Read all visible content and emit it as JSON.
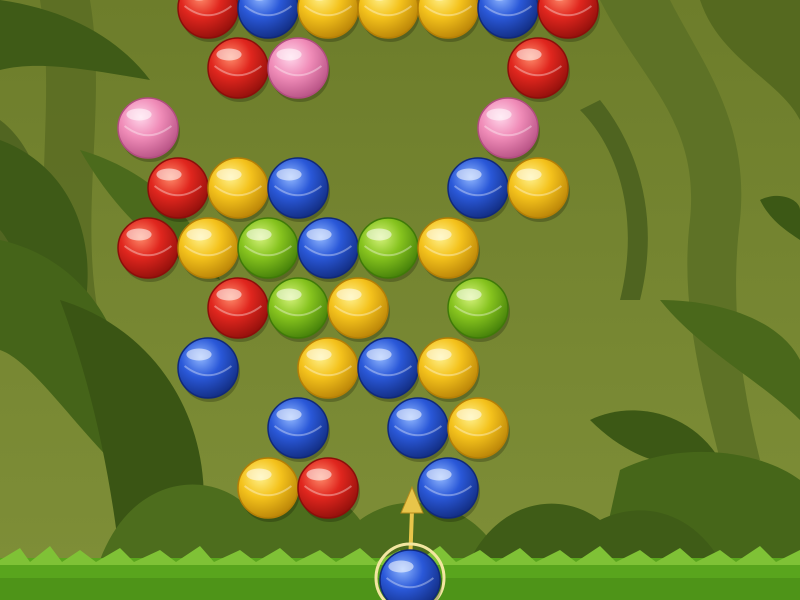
{
  "theme": {
    "sky": "#6f7f2e",
    "jungle_dark": "#3f5a18",
    "jungle_mid": "#556f22",
    "jungle_light": "#7e9238",
    "grass": "#5aa61f",
    "grass_light": "#8cc63f",
    "arrow": "#e8c54a"
  },
  "bubble_colors": {
    "red": {
      "base": "#e0261e",
      "light": "#ff8a6a",
      "dark": "#8c0e0a"
    },
    "blue": {
      "base": "#2a58d8",
      "light": "#8fb6ff",
      "dark": "#10297a"
    },
    "yellow": {
      "base": "#f4c21c",
      "light": "#fff08a",
      "dark": "#b57f06"
    },
    "pink": {
      "base": "#f08cb8",
      "light": "#ffd6ea",
      "dark": "#b24d80"
    },
    "green": {
      "base": "#86c31e",
      "light": "#d4f27a",
      "dark": "#3f7a08"
    }
  },
  "bubble_icon": {
    "red": "bubble-red-icon",
    "blue": "bubble-blue-icon",
    "yellow": "bubble-yellow-icon",
    "pink": "bubble-pink-icon",
    "green": "bubble-green-icon"
  },
  "grid": [
    {
      "row": 0,
      "cells": [
        {
          "col": 3,
          "color": "red"
        },
        {
          "col": 4,
          "color": "blue"
        },
        {
          "col": 5,
          "color": "yellow"
        },
        {
          "col": 6,
          "color": "yellow"
        },
        {
          "col": 7,
          "color": "yellow"
        },
        {
          "col": 8,
          "color": "blue"
        },
        {
          "col": 9,
          "color": "red"
        }
      ]
    },
    {
      "row": 1,
      "cells": [
        {
          "col": 3,
          "color": "red"
        },
        {
          "col": 4,
          "color": "pink"
        },
        {
          "col": 8,
          "color": "red"
        }
      ]
    },
    {
      "row": 2,
      "cells": [
        {
          "col": 2,
          "color": "pink"
        },
        {
          "col": 8,
          "color": "pink"
        }
      ]
    },
    {
      "row": 3,
      "cells": [
        {
          "col": 2,
          "color": "red"
        },
        {
          "col": 3,
          "color": "yellow"
        },
        {
          "col": 4,
          "color": "blue"
        },
        {
          "col": 7,
          "color": "blue"
        },
        {
          "col": 8,
          "color": "yellow"
        }
      ]
    },
    {
      "row": 4,
      "cells": [
        {
          "col": 2,
          "color": "red"
        },
        {
          "col": 3,
          "color": "yellow"
        },
        {
          "col": 4,
          "color": "green"
        },
        {
          "col": 5,
          "color": "blue"
        },
        {
          "col": 6,
          "color": "green"
        },
        {
          "col": 7,
          "color": "yellow"
        }
      ]
    },
    {
      "row": 5,
      "cells": [
        {
          "col": 3,
          "color": "red"
        },
        {
          "col": 4,
          "color": "green"
        },
        {
          "col": 5,
          "color": "yellow"
        },
        {
          "col": 7,
          "color": "green"
        }
      ]
    },
    {
      "row": 6,
      "cells": [
        {
          "col": 3,
          "color": "blue"
        },
        {
          "col": 5,
          "color": "yellow"
        },
        {
          "col": 6,
          "color": "blue"
        },
        {
          "col": 7,
          "color": "yellow"
        }
      ]
    },
    {
      "row": 7,
      "cells": [
        {
          "col": 4,
          "color": "blue"
        },
        {
          "col": 6,
          "color": "blue"
        },
        {
          "col": 7,
          "color": "yellow"
        }
      ]
    },
    {
      "row": 8,
      "cells": [
        {
          "col": 4,
          "color": "yellow"
        },
        {
          "col": 5,
          "color": "red"
        },
        {
          "col": 7,
          "color": "blue"
        }
      ]
    }
  ],
  "shooter": {
    "current_bubble": "blue",
    "arrow_icon": "aim-arrow-icon"
  }
}
